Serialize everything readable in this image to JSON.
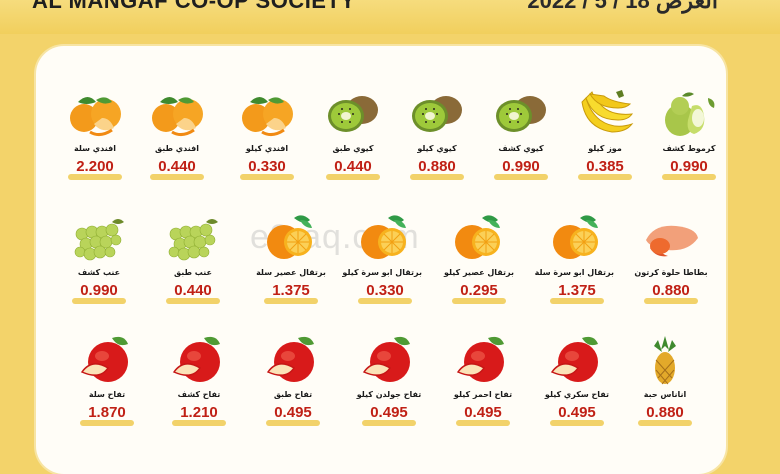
{
  "header": {
    "brand": "AL MANGAF CO-OP SOCIETY",
    "date": "2022 / 5 / 18",
    "date_label": "العرض"
  },
  "watermark": "e3raq.com",
  "colors": {
    "price": "#c02015",
    "background": "#f3d36a",
    "panel": "#fffdf7"
  },
  "rows": [
    [
      {
        "name": "كرموط كشف",
        "price": "0.990",
        "icon": "pear-icon"
      },
      {
        "name": "موز كيلو",
        "price": "0.385",
        "icon": "banana-icon"
      },
      {
        "name": "كيوي كشف",
        "price": "0.990",
        "icon": "kiwi-icon"
      },
      {
        "name": "كيوي كيلو",
        "price": "0.880",
        "icon": "kiwi-icon"
      },
      {
        "name": "كيوي طبق",
        "price": "0.440",
        "icon": "kiwi-icon"
      },
      {
        "name": "افندي كيلو",
        "price": "0.330",
        "icon": "mandarin-icon"
      },
      {
        "name": "افندي طبق",
        "price": "0.440",
        "icon": "mandarin-icon"
      },
      {
        "name": "افندي سلة",
        "price": "2.200",
        "icon": "mandarin-icon"
      }
    ],
    [
      {
        "name": "بطاطا حلوة كرتون",
        "price": "0.880",
        "icon": "sweet-potato-icon"
      },
      {
        "name": "برتقال ابو سرة سلة",
        "price": "1.375",
        "icon": "orange-icon"
      },
      {
        "name": "برتقال عصير كيلو",
        "price": "0.295",
        "icon": "orange-icon"
      },
      {
        "name": "برتقال ابو سرة كيلو",
        "price": "0.330",
        "icon": "orange-icon"
      },
      {
        "name": "برتقال عصير سلة",
        "price": "1.375",
        "icon": "orange-icon"
      },
      {
        "name": "عنب طبق",
        "price": "0.440",
        "icon": "grapes-icon"
      },
      {
        "name": "عنب كشف",
        "price": "0.990",
        "icon": "grapes-icon"
      }
    ],
    [
      {
        "name": "اناناس حبة",
        "price": "0.880",
        "icon": "pineapple-icon"
      },
      {
        "name": "تفاح سكري كيلو",
        "price": "0.495",
        "icon": "apple-icon"
      },
      {
        "name": "تفاح احمر كيلو",
        "price": "0.495",
        "icon": "apple-icon"
      },
      {
        "name": "تفاح جولدن كيلو",
        "price": "0.495",
        "icon": "apple-icon"
      },
      {
        "name": "تفاح طبق",
        "price": "0.495",
        "icon": "apple-icon"
      },
      {
        "name": "تفاح كشف",
        "price": "1.210",
        "icon": "apple-icon"
      },
      {
        "name": "تفاح سلة",
        "price": "1.870",
        "icon": "apple-icon"
      }
    ]
  ]
}
